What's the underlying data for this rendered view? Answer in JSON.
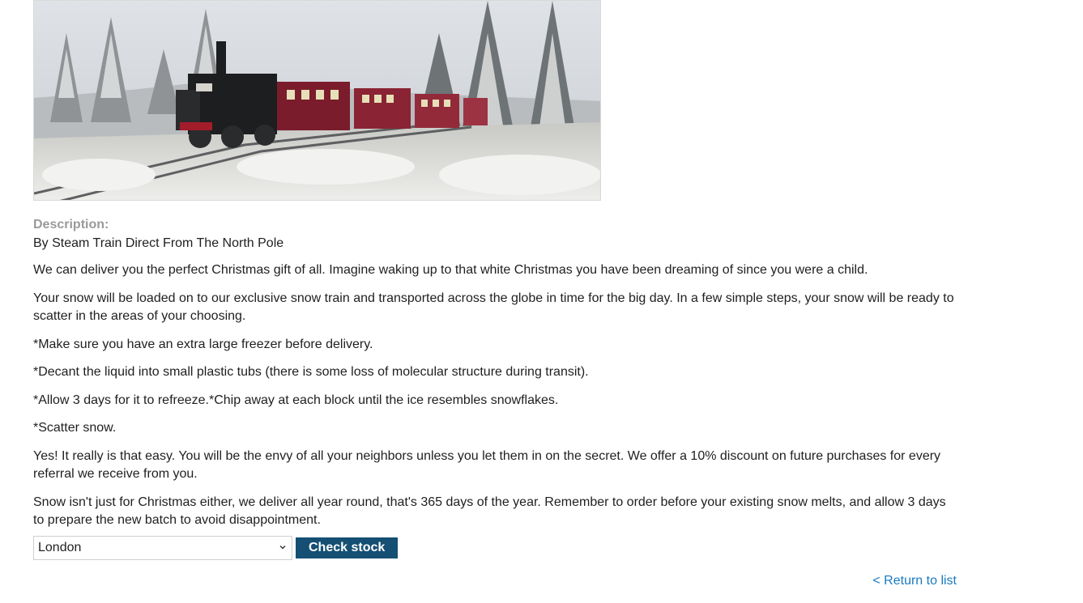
{
  "product": {
    "image_alt": "steam train in snowy forest",
    "description_heading": "Description:",
    "subtitle": "By Steam Train Direct From The North Pole",
    "paragraphs": [
      "We can deliver you the perfect Christmas gift of all. Imagine waking up to that white Christmas you have been dreaming of since you were a child.",
      "Your snow will be loaded on to our exclusive snow train and transported across the globe in time for the big day. In a few simple steps, your snow will be ready to scatter in the areas of your choosing.",
      "*Make sure you have an extra large freezer before delivery.",
      "*Decant the liquid into small plastic tubs (there is some loss of molecular structure during transit).",
      "*Allow 3 days for it to refreeze.*Chip away at each block until the ice resembles snowflakes.",
      "*Scatter snow.",
      "Yes! It really is that easy. You will be the envy of all your neighbors unless you let them in on the secret. We offer a 10% discount on future purchases for every referral we receive from you.",
      "Snow isn't just for Christmas either, we deliver all year round, that's 365 days of the year. Remember to order before your existing snow melts, and allow 3 days to prepare the new batch to avoid disappointment."
    ]
  },
  "stock_check": {
    "selected_city": "London",
    "button_label": "Check stock"
  },
  "nav": {
    "return_link": "< Return to list"
  },
  "colors": {
    "button_bg": "#154f73",
    "link": "#1a7ac0",
    "heading_grey": "#9a9a9a"
  }
}
